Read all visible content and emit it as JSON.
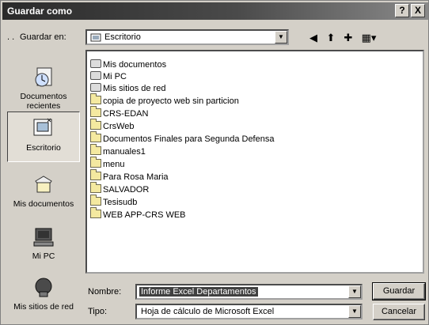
{
  "window": {
    "title": "Guardar como"
  },
  "titlebar": {
    "help": "?",
    "close": "X"
  },
  "lookin": {
    "label": "Guardar en:",
    "value": "Escritorio",
    "dots": ". ."
  },
  "toolbar": {
    "back": "◀",
    "up": "⬆",
    "new_folder": "✚",
    "views": "▦▾"
  },
  "places": [
    {
      "label": "Documentos recientes",
      "icon": "recent-documents-icon"
    },
    {
      "label": "Escritorio",
      "icon": "desktop-icon"
    },
    {
      "label": "Mis documentos",
      "icon": "my-documents-icon"
    },
    {
      "label": "Mi PC",
      "icon": "my-computer-icon"
    },
    {
      "label": "Mis sitios de red",
      "icon": "network-places-icon"
    }
  ],
  "files": [
    {
      "name": "Mis documentos",
      "icon": "special"
    },
    {
      "name": "Mi PC",
      "icon": "special"
    },
    {
      "name": "Mis sitios de red",
      "icon": "special"
    },
    {
      "name": "copia de proyecto web sin particion",
      "icon": "folder"
    },
    {
      "name": "CRS-EDAN",
      "icon": "folder"
    },
    {
      "name": "CrsWeb",
      "icon": "folder"
    },
    {
      "name": "Documentos Finales para Segunda Defensa",
      "icon": "folder"
    },
    {
      "name": "manuales1",
      "icon": "folder"
    },
    {
      "name": "menu",
      "icon": "folder"
    },
    {
      "name": "Para Rosa Maria",
      "icon": "folder"
    },
    {
      "name": "SALVADOR",
      "icon": "folder"
    },
    {
      "name": "Tesisudb",
      "icon": "folder"
    },
    {
      "name": "WEB APP-CRS WEB",
      "icon": "folder"
    }
  ],
  "filename": {
    "label": "Nombre:",
    "value": "Informe Excel Departamentos"
  },
  "filetype": {
    "label": "Tipo:",
    "value": "Hoja de cálculo de Microsoft Excel"
  },
  "buttons": {
    "save": "Guardar",
    "cancel": "Cancelar"
  }
}
